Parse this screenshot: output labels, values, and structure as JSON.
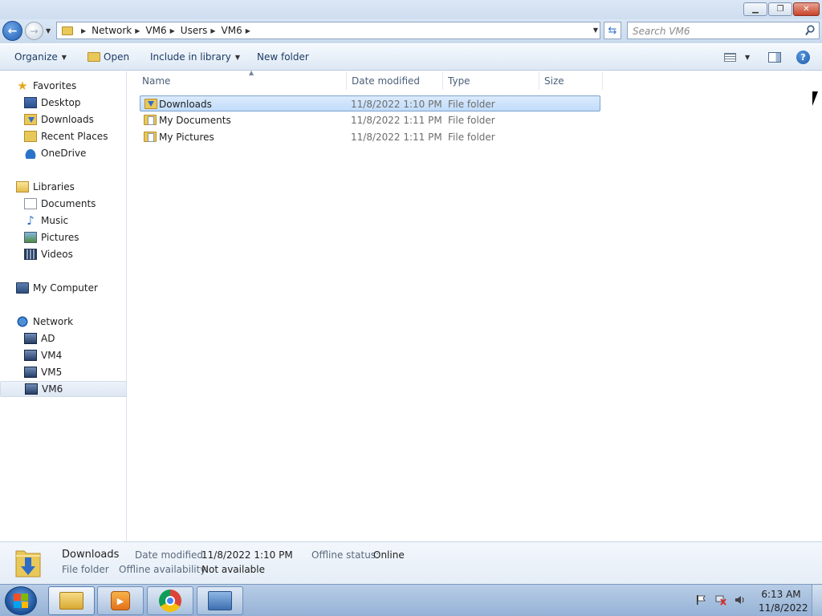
{
  "window": {
    "controls": {
      "minimize": "▁",
      "maximize": "❐",
      "close": "✕"
    }
  },
  "address": {
    "crumbs": [
      "Network",
      "VM6",
      "Users",
      "VM6"
    ],
    "search_placeholder": "Search VM6"
  },
  "toolbar": {
    "organize": "Organize",
    "open": "Open",
    "include_in_library": "Include in library",
    "new_folder": "New folder"
  },
  "nav": {
    "favorites": {
      "label": "Favorites",
      "items": [
        "Desktop",
        "Downloads",
        "Recent Places",
        "OneDrive"
      ]
    },
    "libraries": {
      "label": "Libraries",
      "items": [
        "Documents",
        "Music",
        "Pictures",
        "Videos"
      ]
    },
    "computer": {
      "label": "My Computer"
    },
    "network": {
      "label": "Network",
      "items": [
        "AD",
        "VM4",
        "VM5",
        "VM6"
      ],
      "selected": "VM6"
    }
  },
  "files": {
    "columns": [
      "Name",
      "Date modified",
      "Type",
      "Size"
    ],
    "rows": [
      {
        "name": "Downloads",
        "date": "11/8/2022 1:10 PM",
        "type": "File folder",
        "size": "",
        "icon": "downloads-folder-icon",
        "selected": true
      },
      {
        "name": "My Documents",
        "date": "11/8/2022 1:11 PM",
        "type": "File folder",
        "size": "",
        "icon": "documents-folder-icon",
        "selected": false
      },
      {
        "name": "My Pictures",
        "date": "11/8/2022 1:11 PM",
        "type": "File folder",
        "size": "",
        "icon": "pictures-folder-icon",
        "selected": false
      }
    ]
  },
  "details": {
    "name": "Downloads",
    "type": "File folder",
    "date_label": "Date modified:",
    "date_value": "11/8/2022 1:10 PM",
    "offline_status_label": "Offline status:",
    "offline_status_value": "Online",
    "offline_availability_label": "Offline availability:",
    "offline_availability_value": "Not available"
  },
  "taskbar": {
    "time": "6:13 AM",
    "date": "11/8/2022",
    "apps": [
      "windows-explorer-icon",
      "media-player-icon",
      "chrome-icon",
      "server-manager-icon"
    ]
  },
  "colors": {
    "selection": "#cce4fb",
    "titlebar": "#cddcef",
    "accent": "#1f5fb4"
  }
}
